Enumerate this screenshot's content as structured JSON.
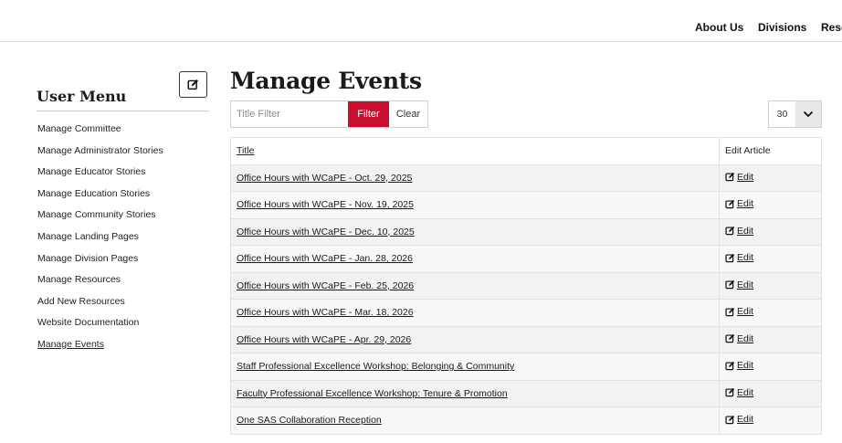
{
  "nav": {
    "items": [
      "About Us",
      "Divisions",
      "Reso"
    ]
  },
  "sidebar": {
    "title": "User Menu",
    "items": [
      "Manage Committee",
      "Manage Administrator Stories",
      "Manage Educator Stories",
      "Manage Education Stories",
      "Manage Community Stories",
      "Manage Landing Pages",
      "Manage Division Pages",
      "Manage Resources",
      "Add New Resources",
      "Website Documentation",
      "Manage Events"
    ],
    "active_item": "Manage Events"
  },
  "main": {
    "title": "Manage Events",
    "filter": {
      "placeholder": "Title Filter",
      "value": "",
      "filter_label": "Filter",
      "clear_label": "Clear"
    },
    "page_size": "30",
    "table": {
      "columns": [
        "Title",
        "Edit Article"
      ],
      "edit_label": "Edit",
      "rows": [
        "Office Hours with WCaPE - Oct. 29, 2025",
        "Office Hours with WCaPE - Nov. 19, 2025",
        "Office Hours with WCaPE - Dec. 10, 2025",
        "Office Hours with WCaPE - Jan. 28, 2026",
        "Office Hours with WCaPE - Feb. 25, 2026",
        "Office Hours with WCaPE - Mar. 18, 2026",
        "Office Hours with WCaPE - Apr. 29, 2026",
        "Staff Professional Excellence Workshop: Belonging & Community",
        "Faculty Professional Excellence Workshop: Tenure & Promotion",
        "One SAS Collaboration Reception"
      ]
    }
  },
  "colors": {
    "accent": "#c8102e",
    "row_alt": "#f2f2f2"
  },
  "icons": {
    "edit": "edit-square-icon",
    "dropdown": "chevron-down-icon"
  }
}
